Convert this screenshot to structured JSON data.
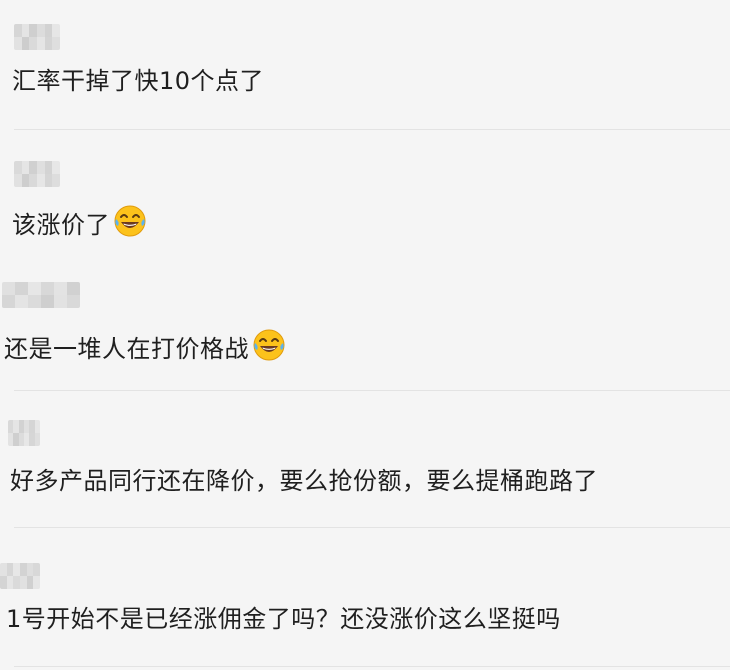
{
  "comments": [
    {
      "text": "汇率干掉了快10个点了",
      "emoji": ""
    },
    {
      "text": "该涨价了",
      "emoji": "laughing-with-tears-emoji"
    },
    {
      "text": "还是一堆人在打价格战",
      "emoji": "laughing-with-tears-emoji"
    },
    {
      "text": "好多产品同行还在降价，要么抢份额，要么提桶跑路了",
      "emoji": ""
    },
    {
      "text": "1号开始不是已经涨佣金了吗？还没涨价这么坚挺吗",
      "emoji": ""
    }
  ]
}
